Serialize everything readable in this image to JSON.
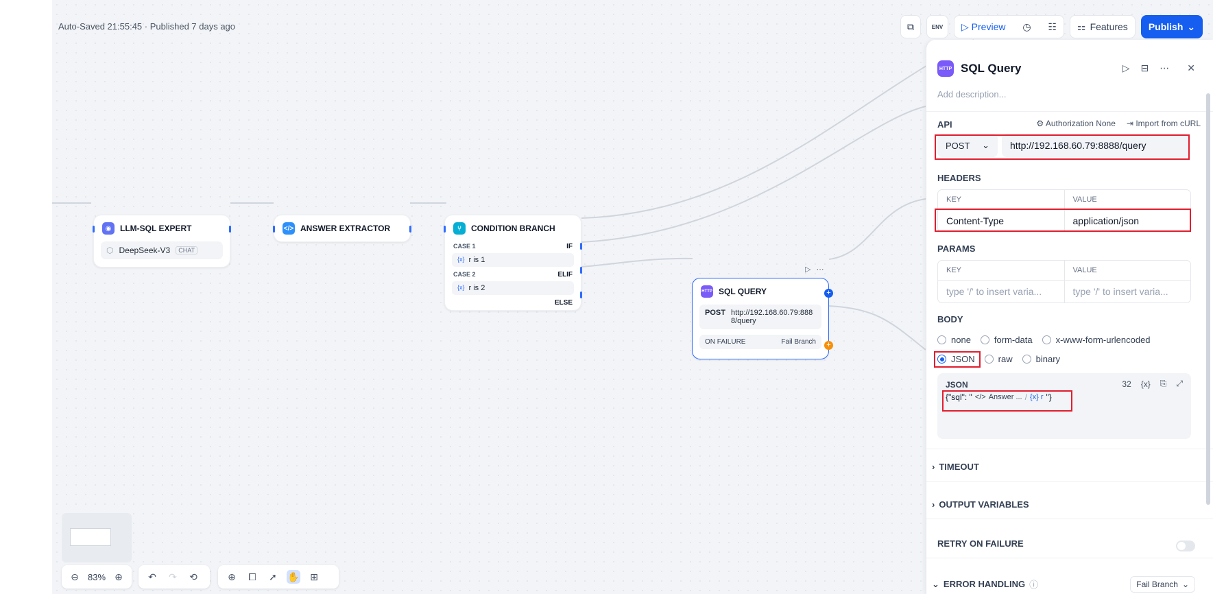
{
  "header": {
    "autosave_text": "Auto-Saved 21:55:45 · Published 7 days ago",
    "preview_label": "Preview",
    "env_label": "ENV",
    "features_label": "Features",
    "publish_label": "Publish"
  },
  "canvas": {
    "nodes": {
      "llm": {
        "title": "LLM-SQL EXPERT",
        "model": "DeepSeek-V3",
        "badge": "CHAT"
      },
      "extractor": {
        "title": "ANSWER EXTRACTOR"
      },
      "branch": {
        "title": "CONDITION BRANCH",
        "case1_label": "CASE 1",
        "case1_tag": "IF",
        "case1_var": "{x}",
        "case1_cond": "r is 1",
        "case2_label": "CASE 2",
        "case2_tag": "ELIF",
        "case2_var": "{x}",
        "case2_cond": "r is 2",
        "else_tag": "ELSE"
      },
      "sql": {
        "title": "SQL QUERY",
        "icon_text": "HTTP",
        "method": "POST",
        "url": "http://192.168.60.79:8888/query",
        "on_failure": "ON FAILURE",
        "fail_branch": "Fail Branch"
      }
    },
    "zoom": "83%"
  },
  "panel": {
    "title": "SQL Query",
    "icon_text": "HTTP",
    "description_placeholder": "Add description...",
    "api": {
      "label": "API",
      "authorization": "Authorization None",
      "import_curl": "Import from cURL",
      "method": "POST",
      "url": "http://192.168.60.79:8888/query"
    },
    "headers": {
      "label": "HEADERS",
      "col_key": "KEY",
      "col_value": "VALUE",
      "rows": [
        {
          "key": "Content-Type",
          "value": "application/json"
        }
      ]
    },
    "params": {
      "label": "PARAMS",
      "col_key": "KEY",
      "col_value": "VALUE",
      "key_placeholder": "type '/' to insert varia...",
      "value_placeholder": "type '/' to insert varia..."
    },
    "body": {
      "label": "BODY",
      "options": [
        "none",
        "form-data",
        "x-www-form-urlencoded",
        "JSON",
        "raw",
        "binary"
      ],
      "selected": "JSON",
      "json_label": "JSON",
      "json_count": "32",
      "json_var_icon": "{x}",
      "json_prefix": "{\"sql\": \"",
      "json_node_chip": "Answer ...",
      "json_sep": "/",
      "json_var_chip": "{x} r",
      "json_suffix": "\"}"
    },
    "sections": {
      "timeout": "TIMEOUT",
      "output_variables": "OUTPUT VARIABLES",
      "retry_on_failure": "RETRY ON FAILURE",
      "error_handling": "ERROR HANDLING",
      "error_handling_value": "Fail Branch"
    }
  },
  "colors": {
    "accent": "#155eef",
    "highlight": "#e11d2e",
    "llm_icon": "#6172f3",
    "extractor_icon": "#2e90fa",
    "branch_icon": "#06aed4",
    "http_icon": "#7a5af8",
    "fail_port": "#f79009"
  }
}
